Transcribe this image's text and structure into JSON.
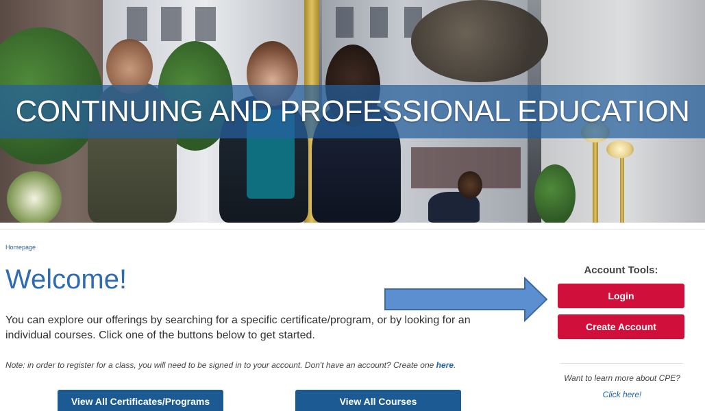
{
  "hero": {
    "title": "CONTINUING AND PROFESSIONAL EDUCATION"
  },
  "breadcrumb": {
    "home": "Homepage"
  },
  "main": {
    "heading": "Welcome!",
    "intro": "You can explore our offerings by searching for a specific certificate/program, or by looking for an individual courses. Click one of the buttons below to get started.",
    "note_text": "Note: in order to register for a class, you will need to be signed in to your account. Don't have an account? Create one ",
    "note_link": "here",
    "note_end": ".",
    "buttons": {
      "certificates": "View All Certificates/Programs",
      "courses": "View All Courses"
    }
  },
  "sidebar": {
    "heading": "Account Tools:",
    "login": "Login",
    "create_account": "Create Account",
    "learn_more": "Want to learn more about CPE?",
    "click_here": "Click here!"
  },
  "colors": {
    "accent_blue": "#2e6bb0",
    "button_blue": "#1b5a92",
    "button_red": "#d0103a",
    "banner_blue": "#26609c",
    "arrow_blue": "#5b8fd0"
  }
}
